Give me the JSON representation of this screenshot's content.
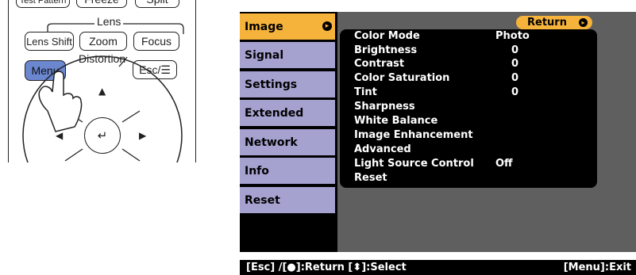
{
  "remote": {
    "buttons": {
      "test_pattern": "Test Pattern",
      "freeze": "Freeze",
      "split": "Split",
      "lens_shift": "Lens Shift",
      "zoom": "Zoom",
      "focus": "Focus",
      "menu": "Menu",
      "esc": "Esc/☰"
    },
    "labels": {
      "lens": "Lens",
      "distortion": "Distortion"
    }
  },
  "osd": {
    "tabs": [
      {
        "label": "Image",
        "active": true
      },
      {
        "label": "Signal"
      },
      {
        "label": "Settings"
      },
      {
        "label": "Extended"
      },
      {
        "label": "Network"
      },
      {
        "label": "Info"
      },
      {
        "label": "Reset"
      }
    ],
    "return_label": "Return",
    "items": [
      {
        "label": "Color Mode",
        "value": "Photo"
      },
      {
        "label": "Brightness",
        "value": "0"
      },
      {
        "label": "Contrast",
        "value": "0"
      },
      {
        "label": "Color Saturation",
        "value": "0"
      },
      {
        "label": "Tint",
        "value": "0"
      },
      {
        "label": "Sharpness",
        "value": ""
      },
      {
        "label": "White Balance",
        "value": ""
      },
      {
        "label": "Image Enhancement",
        "value": ""
      },
      {
        "label": "Advanced",
        "value": ""
      },
      {
        "label": "Light Source Control",
        "value": "Off"
      },
      {
        "label": "Reset",
        "value": ""
      }
    ],
    "footer": {
      "left": "[Esc] /[●]:Return  [⬍]:Select",
      "right": "[Menu]:Exit"
    }
  },
  "colors": {
    "active_tab": "#f6b33c",
    "inactive_tab": "#a5a2d0",
    "menu_button": "#6b87d0",
    "panel_bg": "#5f5f5f"
  }
}
